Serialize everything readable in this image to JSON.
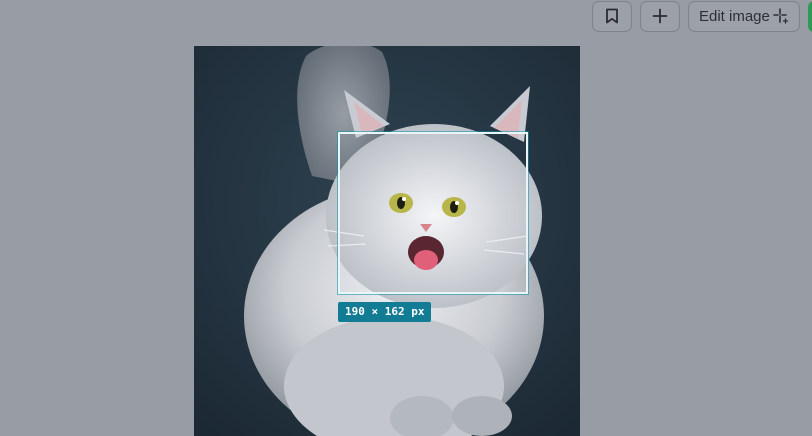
{
  "toolbar": {
    "bookmark_icon": "bookmark-icon",
    "add_icon": "plus-icon",
    "edit_label": "Edit image",
    "edit_icon": "sparkle-icon",
    "accent_color": "#2f9a55"
  },
  "canvas": {
    "background_color": "#989ca4",
    "image_subject": "fluffy grey cat",
    "selection": {
      "size_label": "190 × 162 px",
      "label_color": "#127c95"
    }
  }
}
